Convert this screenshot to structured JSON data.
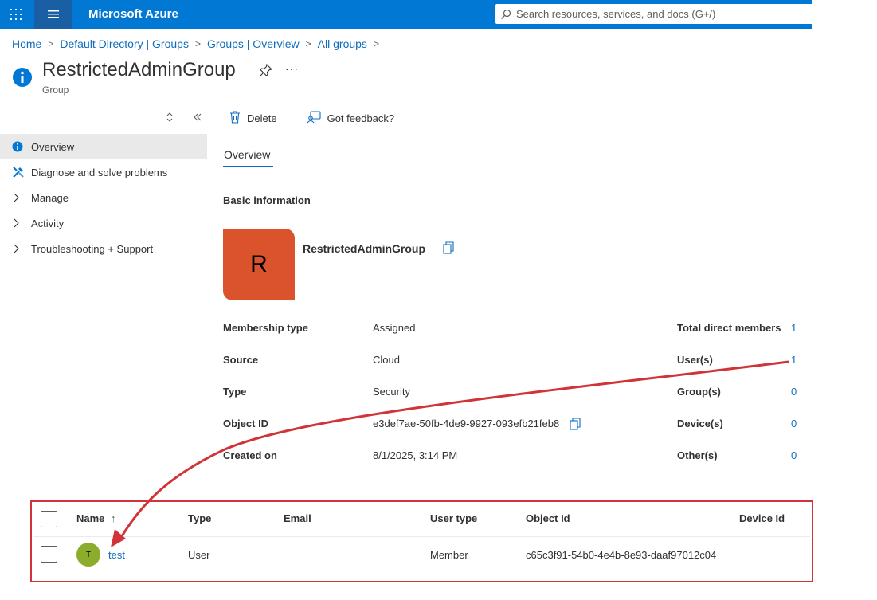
{
  "app": {
    "brand": "Microsoft Azure",
    "search_placeholder": "Search resources, services, and docs (G+/)"
  },
  "breadcrumb": [
    "Home",
    "Default Directory | Groups",
    "Groups | Overview",
    "All groups"
  ],
  "page": {
    "title": "RestrictedAdminGroup",
    "subtitle": "Group",
    "more": "···"
  },
  "sidebar": {
    "items": [
      {
        "label": "Overview",
        "icon": "info-icon",
        "active": true
      },
      {
        "label": "Diagnose and solve problems",
        "icon": "wrench-icon"
      },
      {
        "label": "Manage",
        "icon": "chevron-right-icon"
      },
      {
        "label": "Activity",
        "icon": "chevron-right-icon"
      },
      {
        "label": "Troubleshooting + Support",
        "icon": "chevron-right-icon"
      }
    ]
  },
  "commands": {
    "delete": "Delete",
    "feedback": "Got feedback?"
  },
  "tabs": [
    {
      "label": "Overview",
      "active": true
    }
  ],
  "overview": {
    "section_title": "Basic information",
    "avatar_letter": "R",
    "group_name": "RestrictedAdminGroup",
    "avatar_color": "#da532c",
    "properties": [
      {
        "label": "Membership type",
        "value": "Assigned"
      },
      {
        "label": "Source",
        "value": "Cloud"
      },
      {
        "label": "Type",
        "value": "Security"
      },
      {
        "label": "Object ID",
        "value": "e3def7ae-50fb-4de9-9927-093efb21feb8"
      },
      {
        "label": "Created on",
        "value": "8/1/2025, 3:14 PM"
      }
    ],
    "stats": [
      {
        "label": "Total direct members",
        "value": "1"
      },
      {
        "label": "User(s)",
        "value": "1"
      },
      {
        "label": "Group(s)",
        "value": "0"
      },
      {
        "label": "Device(s)",
        "value": "0"
      },
      {
        "label": "Other(s)",
        "value": "0"
      }
    ]
  },
  "members_table": {
    "columns": [
      "Name",
      "Type",
      "Email",
      "User type",
      "Object Id",
      "Device Id"
    ],
    "sort_indicator": "↑",
    "rows": [
      {
        "avatar": "T",
        "name": "test",
        "type": "User",
        "email": "",
        "user_type": "Member",
        "object_id": "c65c3f91-54b0-4e4b-8e93-daaf97012c04",
        "device_id": ""
      }
    ]
  },
  "colors": {
    "azure_blue": "#0078d4",
    "link": "#0f6cbd",
    "annotation_red": "#d13438"
  }
}
